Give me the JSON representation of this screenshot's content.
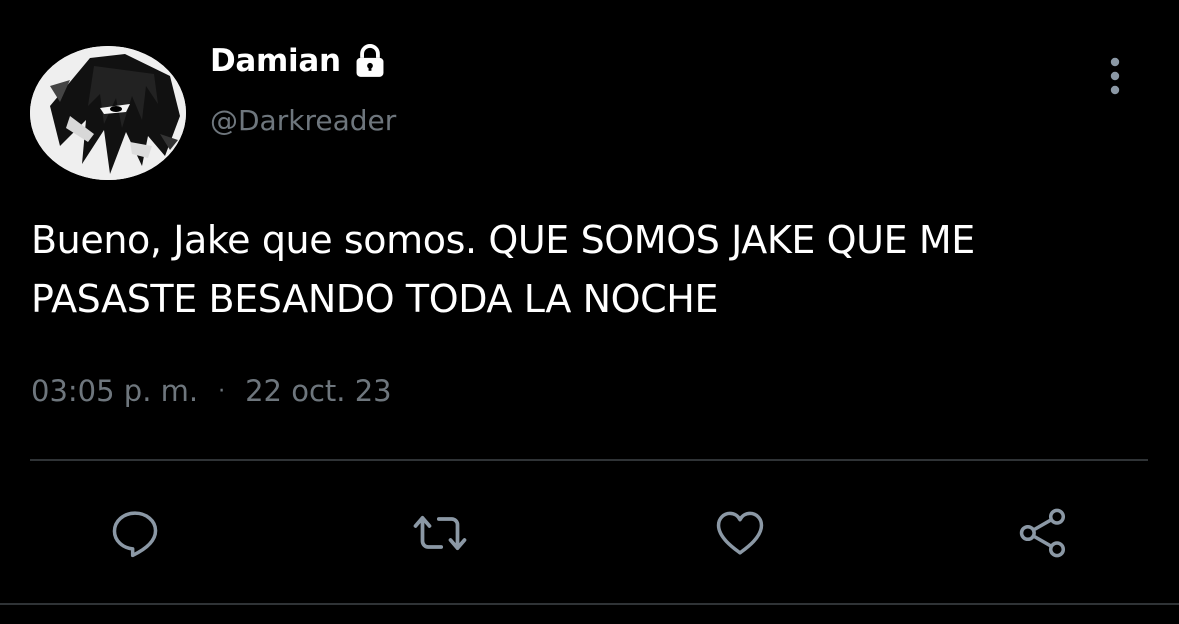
{
  "user": {
    "display_name": "Damian",
    "handle": "@Darkreader",
    "protected_icon": "lock-icon",
    "avatar": "manga-portrait-avatar"
  },
  "tweet": {
    "text": "Bueno, Jake que somos. QUE SOMOS JAKE QUE ME PASASTE BESANDO TODA LA NOCHE",
    "time": "03:05 p. m.",
    "separator": "·",
    "date": "22 oct. 23"
  },
  "actions": [
    {
      "name": "reply",
      "icon": "reply-icon"
    },
    {
      "name": "retweet",
      "icon": "retweet-icon"
    },
    {
      "name": "like",
      "icon": "heart-icon"
    },
    {
      "name": "share",
      "icon": "share-icon"
    }
  ],
  "menu": {
    "icon": "more-vertical-icon"
  },
  "colors": {
    "background": "#000000",
    "primary_text": "#ffffff",
    "secondary_text": "#6e767d",
    "divider": "#2f3336",
    "action_icon": "#8b98a5"
  }
}
